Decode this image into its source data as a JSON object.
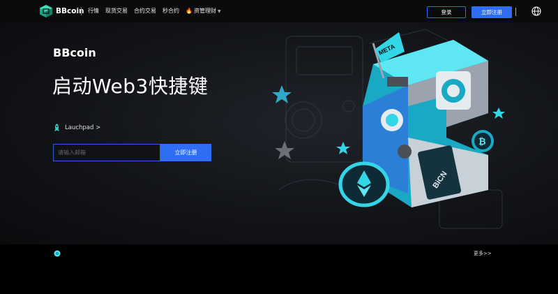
{
  "nav": {
    "brand": "BBcoin",
    "menu": [
      "行情",
      "现货交易",
      "合约交易",
      "秒合约",
      "资管理财"
    ],
    "login": "登录",
    "register": "立即注册"
  },
  "hero": {
    "title_small": "BBcoin",
    "title_large": "启动Web3快捷键",
    "launchpad": "Lauchpad >",
    "email_placeholder": "请输入邮箱",
    "register_button": "立即注册",
    "illustration_labels": {
      "meta": "META",
      "bicn": "BiCN"
    }
  },
  "bottom": {
    "more": "更多>>"
  },
  "colors": {
    "accent": "#2f6ef2",
    "teal": "#33d6e6",
    "background": "#0b0b0d"
  }
}
